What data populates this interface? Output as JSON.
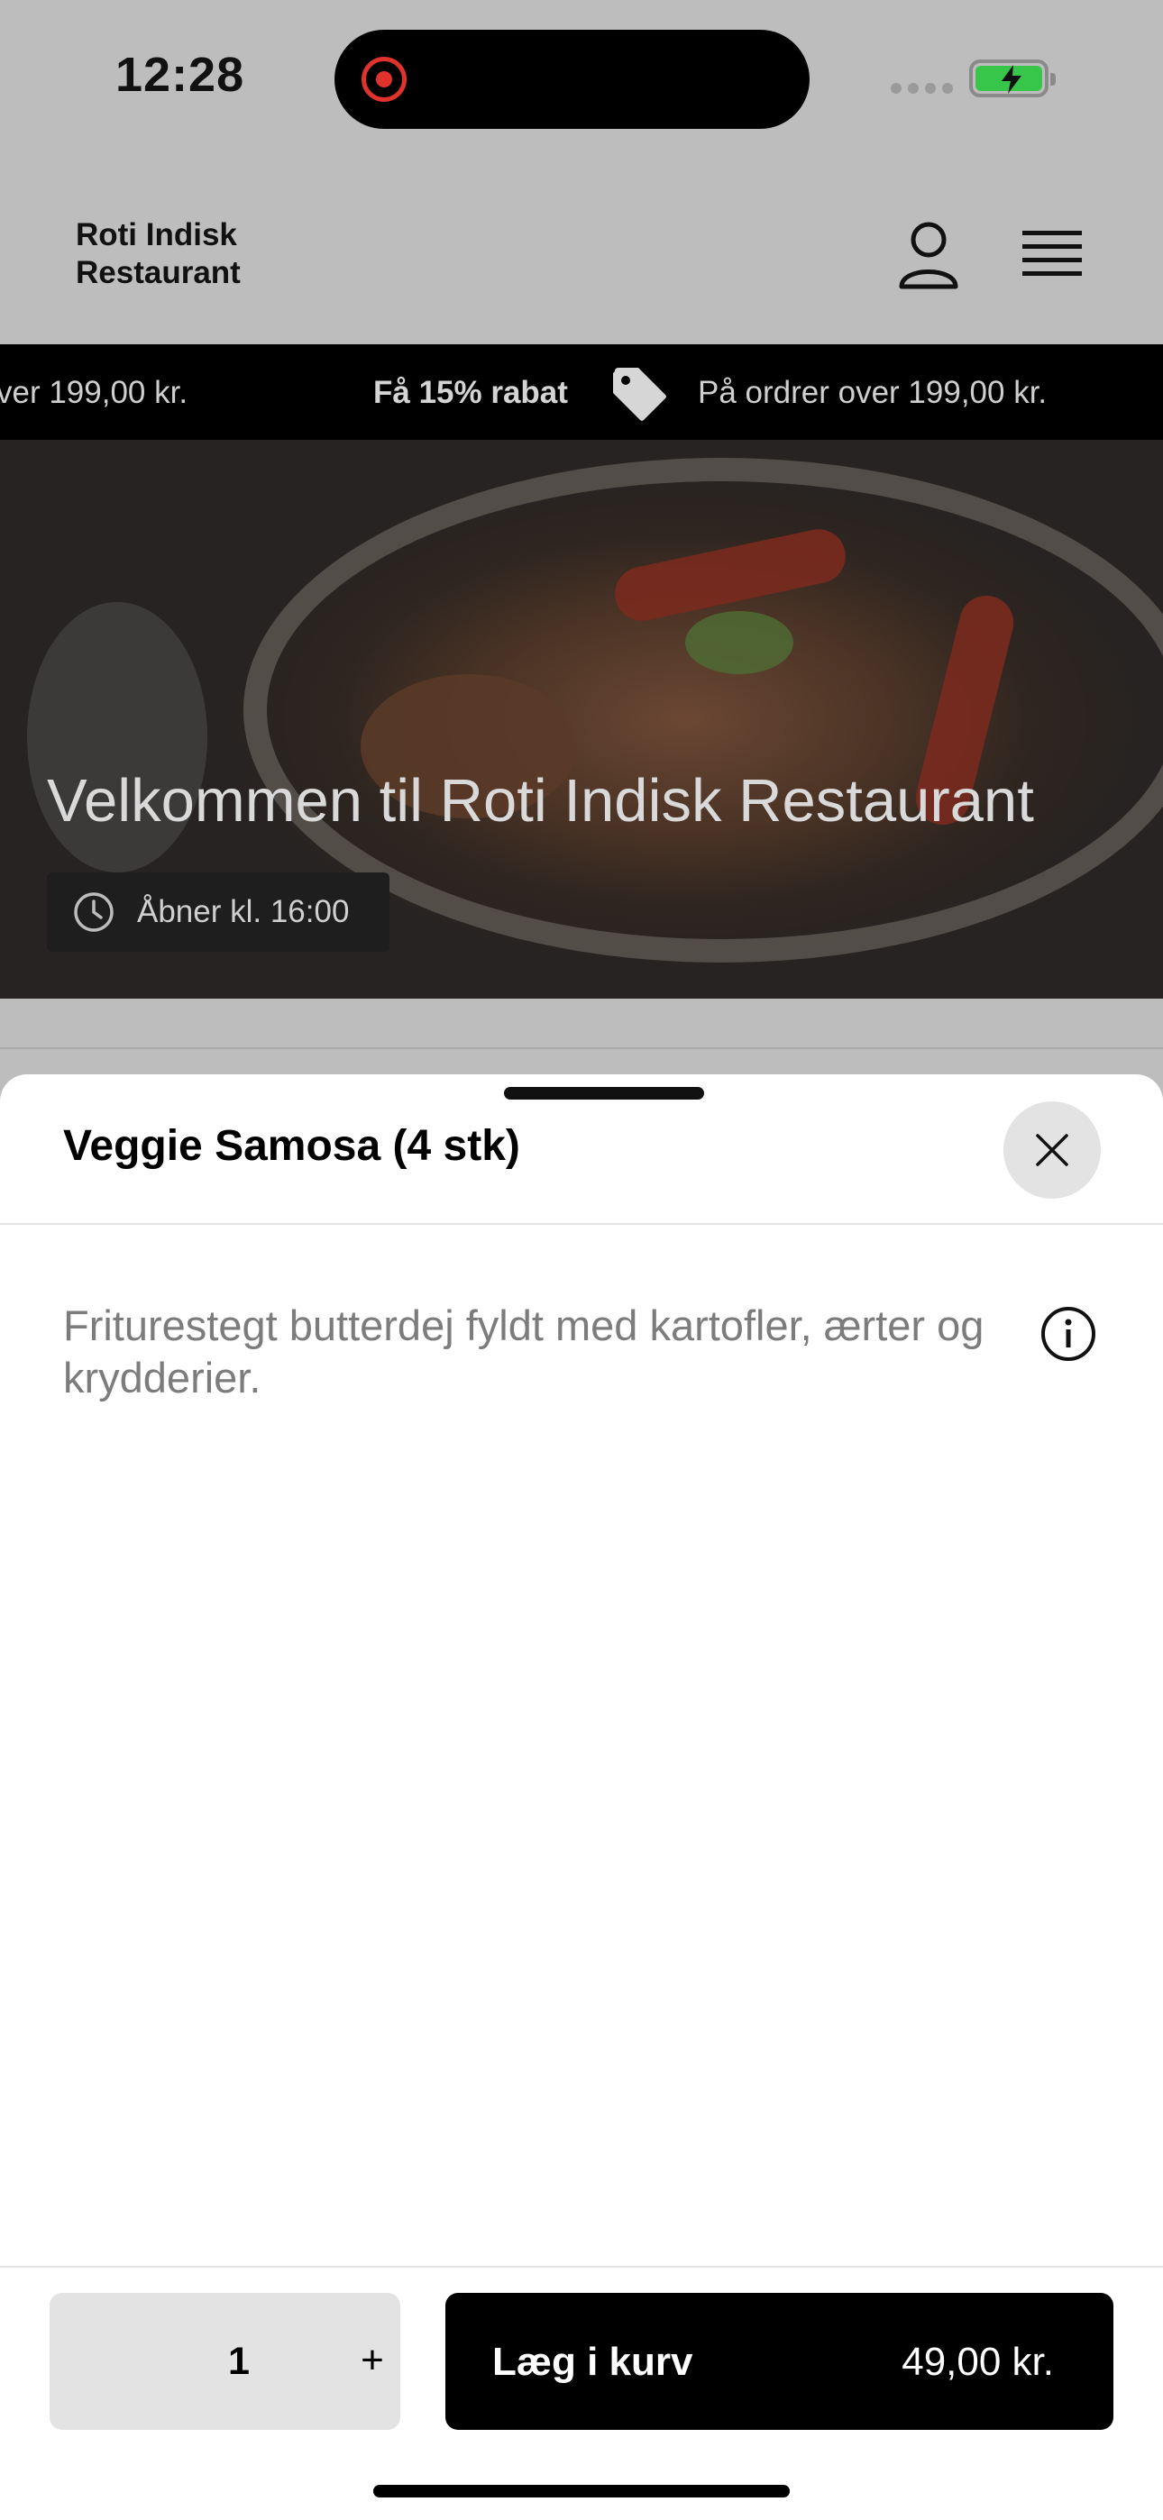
{
  "status_bar": {
    "time": "12:28"
  },
  "header": {
    "brand": "Roti Indisk Restaurant"
  },
  "promo": {
    "left_fragment": "ver 199,00 kr.",
    "discount": "Få 15% rabat",
    "condition": "På ordrer over 199,00 kr."
  },
  "hero": {
    "title": "Velkommen til Roti Indisk Restaurant",
    "hours": "Åbner kl. 16:00"
  },
  "sheet": {
    "title": "Veggie Samosa (4 stk)",
    "description": "Friturestegt butterdej fyldt med kartofler, ærter og krydderier.",
    "quantity": "1",
    "plus_label": "+",
    "add_label": "Læg i kurv",
    "price": "49,00 kr."
  },
  "colors": {
    "accent": "#000000",
    "battery": "#37c64a",
    "record": "#e0332b"
  }
}
